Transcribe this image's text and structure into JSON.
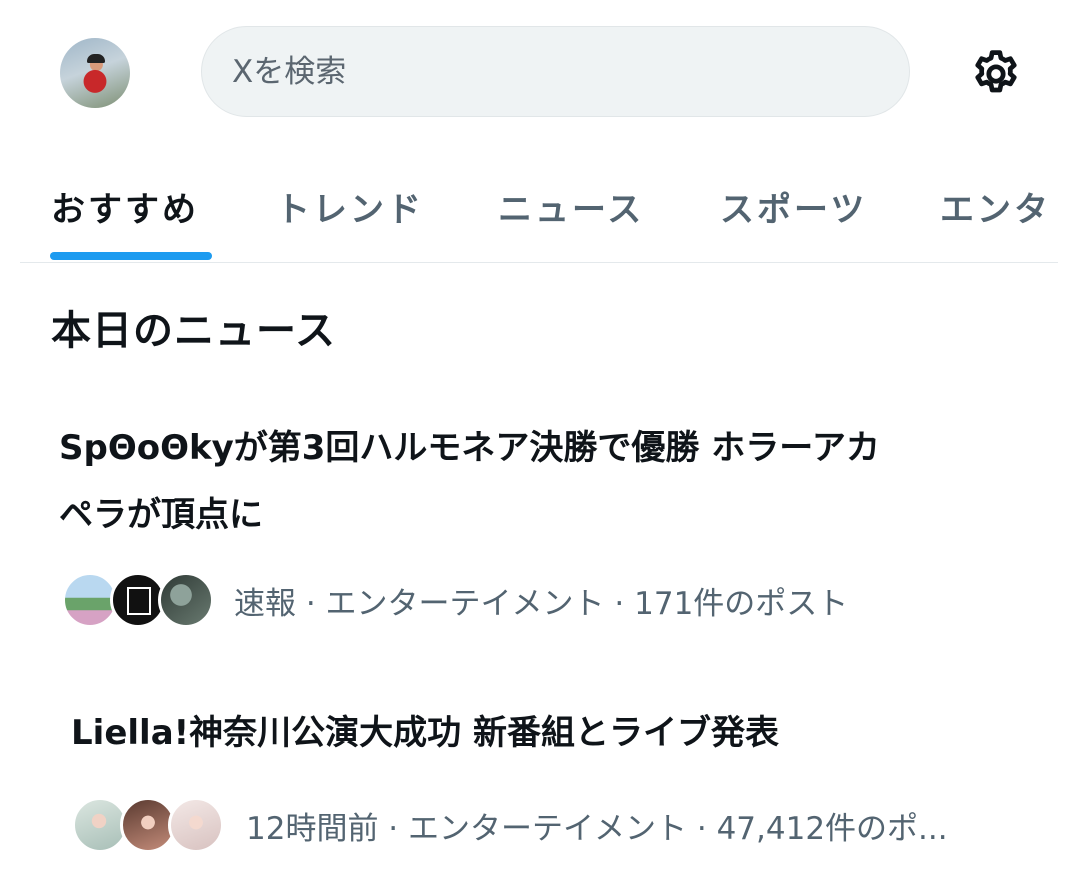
{
  "header": {
    "search_placeholder": "Xを検索"
  },
  "tabs": [
    {
      "label": "おすすめ",
      "active": true
    },
    {
      "label": "トレンド",
      "active": false
    },
    {
      "label": "ニュース",
      "active": false
    },
    {
      "label": "スポーツ",
      "active": false
    },
    {
      "label": "エンタ",
      "active": false
    }
  ],
  "section": {
    "title": "本日のニュース"
  },
  "news": [
    {
      "title_line1": "SpΘoΘkyが第3回ハルモネア決勝で優勝 ホラーアカ",
      "title_line2": "ペラが頂点に",
      "meta": "速報 · エンターテイメント · 171件のポスト"
    },
    {
      "title_line1": "Liella!神奈川公演大成功 新番組とライブ発表",
      "meta": "12時間前 · エンターテイメント · 47,412件のポ..."
    }
  ],
  "icons": {
    "settings": "gear-icon"
  },
  "colors": {
    "accent": "#1d9bf0",
    "text_primary": "#0f1419",
    "text_secondary": "#536471",
    "search_bg": "#eff3f4"
  }
}
